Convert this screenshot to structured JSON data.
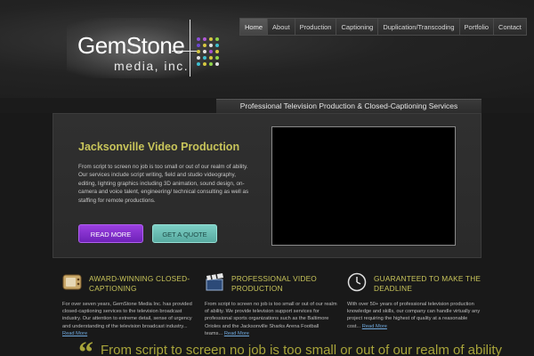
{
  "logo": {
    "main": "GemStone",
    "sub": "media, inc."
  },
  "nav": {
    "items": [
      "Home",
      "About",
      "Production",
      "Captioning",
      "Duplication/Transcoding",
      "Portfolio",
      "Contact"
    ],
    "active": "Home"
  },
  "tagline": "Professional Television Production & Closed-Captioning Services",
  "hero": {
    "title": "Jacksonville Video Production",
    "text": "From script to screen no job is too small or out of our realm of ability. Our services include script writing, field and studio videography, editing, lighting graphics including 3D animation, sound design, on-camera and voice talent, engineering/ technical consulting as well as staffing for remote productions.",
    "read_more": "READ MORE",
    "get_quote": "GET A QUOTE"
  },
  "features": [
    {
      "icon": "tv-icon",
      "title": "AWARD-WINNING CLOSED-CAPTIONING",
      "text": "For over seven years, GemStone Media Inc. has provided closed-captioning services to the television broadcast industry. Our attention to extreme detail, sense of urgency and understanding of the television broadcast industry...",
      "more": "Read More"
    },
    {
      "icon": "clapperboard-icon",
      "title": "PROFESSIONAL VIDEO PRODUCTION",
      "text": "From script to screen no job is too small or out of our realm of ability. We provide television support services for professional sports organizations such as the Baltimore Orioles and the Jacksonville Sharks Arena Football teams...",
      "more": "Read More"
    },
    {
      "icon": "clock-icon",
      "title": "GUARANTEED TO MAKE THE DEADLINE",
      "text": "With over 50+ years of professional television production knowledge and skills, our company can handle virtually any project requiring the highest of quality at a reasonable cost...",
      "more": "Read More"
    }
  ],
  "quote": "From script to screen no job is too small or out of our realm of ability",
  "colors": {
    "accent_gold": "#c8c45a",
    "button_purple": "#7e2fcc",
    "button_teal": "#6cc0b6",
    "link_blue": "#6fa8dc"
  }
}
